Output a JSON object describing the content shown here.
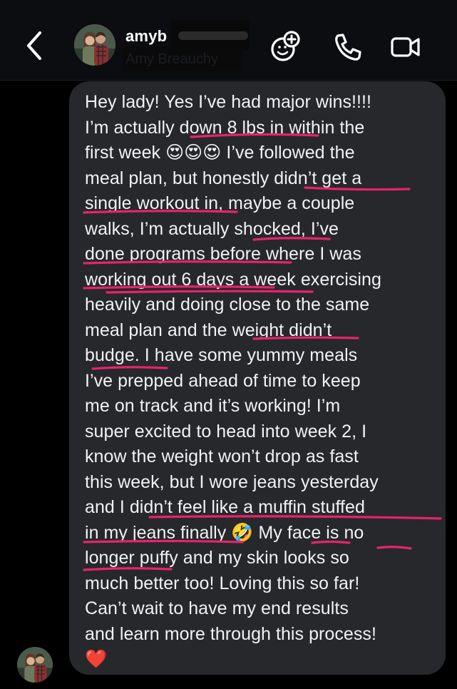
{
  "header": {
    "username": "amyb",
    "full_name": "Amy Breauchy",
    "icons": {
      "back": "chevron-left-icon",
      "effects": "sparkle-face-icon",
      "call": "phone-icon",
      "video": "video-camera-icon"
    }
  },
  "message": {
    "lines": [
      "Hey lady! Yes I’ve had major wins!!!!",
      "I’m actually down 8 lbs in within the",
      "first week 😍😍😍 I’ve followed the",
      "meal plan, but honestly didn’t get a",
      "single workout in, maybe a couple",
      "walks, I’m actually shocked, I’ve",
      "done programs before where I was",
      "working out 6 days a week exercising",
      "heavily and doing close to the same",
      "meal plan and the weight didn’t",
      "budge. I have some yummy meals",
      "I’ve prepped ahead of time to keep",
      "me on track and it’s working! I’m",
      "super excited to head into week 2, I",
      "know the weight won’t drop as fast",
      "this week, but I wore jeans yesterday",
      "and I didn’t feel like a muffin stuffed",
      "in my jeans finally 🤣 My face is no",
      "longer puffy and my skin looks so",
      "much better too! Loving this so far!",
      "Can’t wait to have my end results",
      "and learn more through this process!",
      "❤️"
    ]
  },
  "colors": {
    "background": "#000000",
    "header_bg": "#0b0d10",
    "bubble": "#26282c",
    "text": "#f2f2f2",
    "annotation": "#e8236b"
  }
}
